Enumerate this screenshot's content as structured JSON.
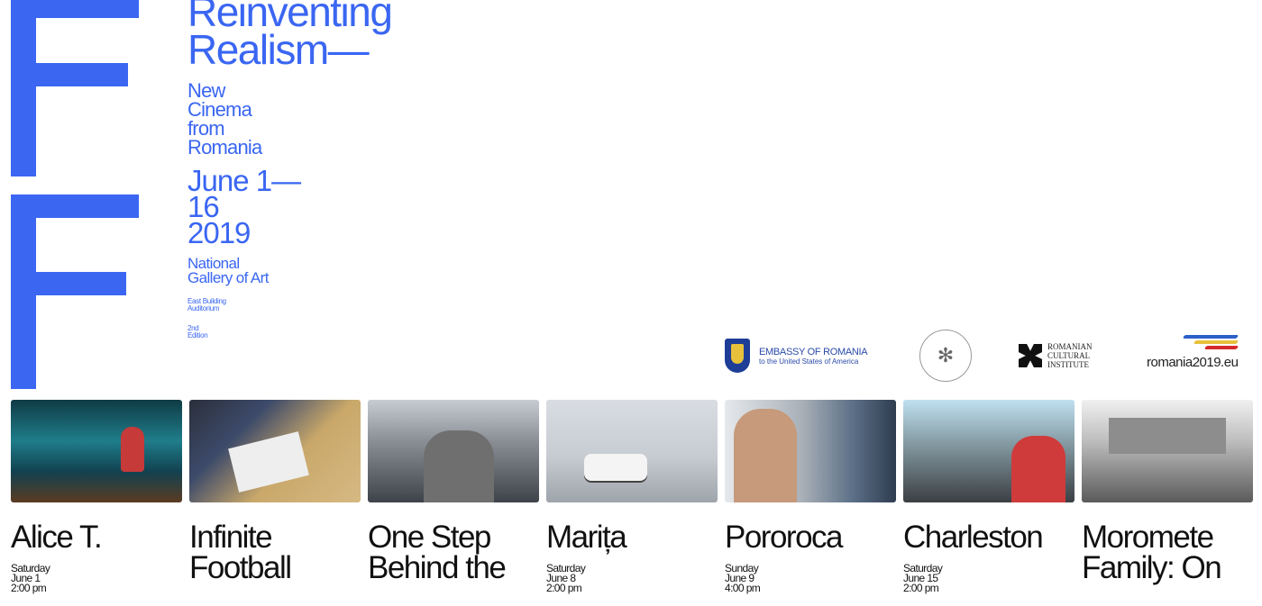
{
  "header": {
    "title_lines": [
      "Reinventing",
      "Realism—"
    ],
    "subtitle_lines": [
      "New",
      "Cinema",
      "from",
      "Romania"
    ],
    "date_lines": [
      "June 1—",
      "16",
      "2019"
    ],
    "venue_lines": [
      "National",
      "Gallery of Art"
    ],
    "location_lines": [
      "East Building",
      "Auditorium"
    ],
    "edition_lines": [
      "2nd",
      "Edition"
    ]
  },
  "logos": {
    "embassy_line1": "EMBASSY OF ROMANIA",
    "embassy_line2": "to the United States of America",
    "rci_lines": [
      "ROMANIAN",
      "CULTURAL",
      "INSTITUTE"
    ],
    "romania2019": "romania2019.eu"
  },
  "films": [
    {
      "title": "Alice T.",
      "meta": [
        "Saturday",
        "June 1",
        "2:00 pm"
      ]
    },
    {
      "title": "Infinite Football",
      "meta": []
    },
    {
      "title": "One Step Behind the",
      "meta": []
    },
    {
      "title": "Marița",
      "meta": [
        "Saturday",
        "June 8",
        "2:00 pm"
      ]
    },
    {
      "title": "Pororoca",
      "meta": [
        "Sunday",
        "June 9",
        "4:00 pm"
      ]
    },
    {
      "title": "Charleston",
      "meta": [
        "Saturday",
        "June 15",
        "2:00 pm"
      ]
    },
    {
      "title": "Moromete Family: On",
      "meta": []
    }
  ],
  "colors": {
    "accent": "#3a66f2"
  }
}
